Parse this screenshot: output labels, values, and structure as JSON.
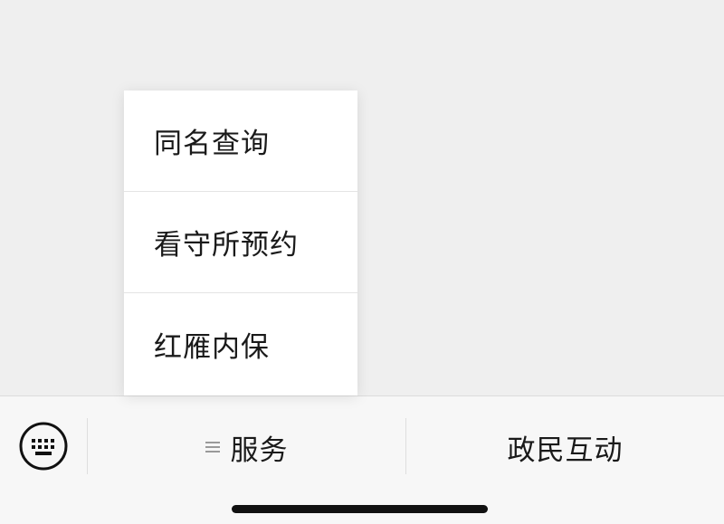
{
  "popup_menu": {
    "items": [
      {
        "label": "同名查询"
      },
      {
        "label": "看守所预约"
      },
      {
        "label": "红雁内保"
      }
    ]
  },
  "bottom_bar": {
    "keyboard_icon": "keyboard-icon",
    "tabs": [
      {
        "label": "服务",
        "icon": "submenu-lines-icon"
      },
      {
        "label": "政民互动"
      }
    ]
  },
  "colors": {
    "background": "#efefef",
    "menu_bg": "#ffffff",
    "bar_bg": "#f7f7f7",
    "text": "#1a1a1a",
    "icon_gray": "#9a9a9a"
  }
}
